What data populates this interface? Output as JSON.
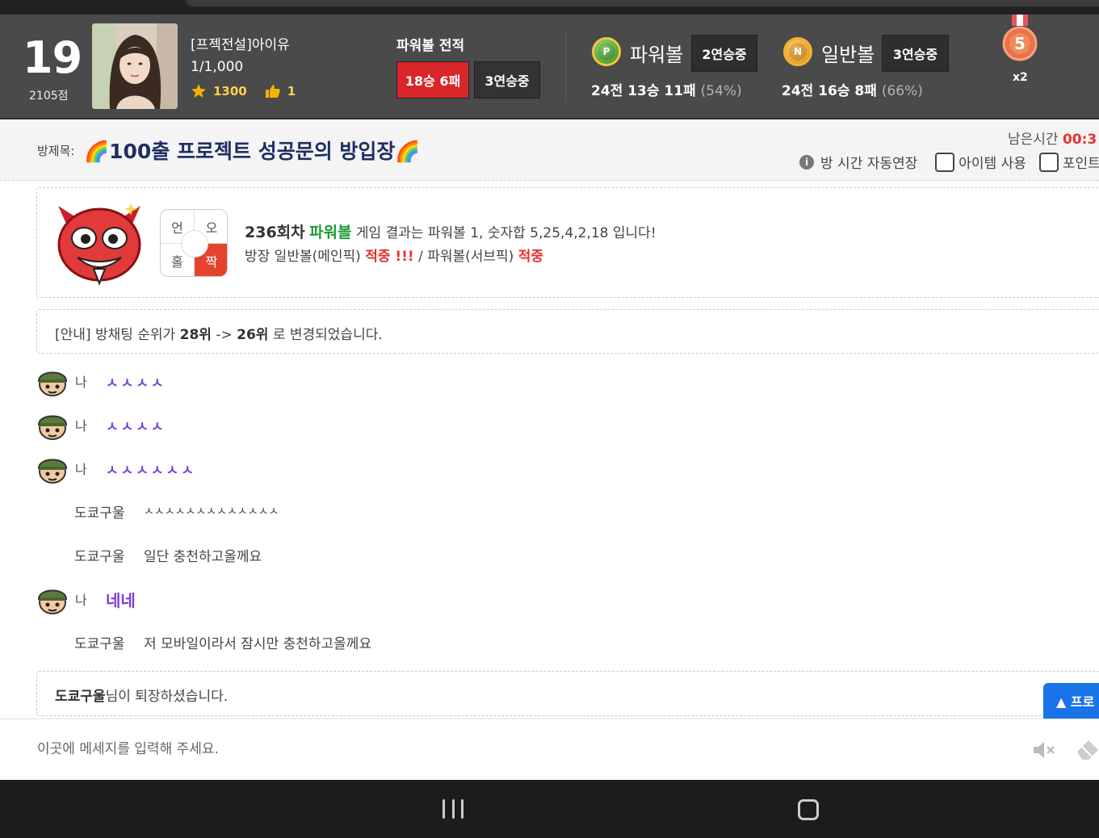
{
  "header": {
    "rank": "19",
    "score": "2105점",
    "nickname": "[프젝전설]아이유",
    "level": "1/1,000",
    "stars": "1300",
    "likes": "1",
    "record_title": "파워볼 전적",
    "record_win": "18승 6패",
    "record_streak": "3연승중",
    "powerball": {
      "label": "파워볼",
      "badge": "P",
      "streak": "2연승중",
      "record": "24전 13승 11패",
      "pct": "(54%)"
    },
    "normalball": {
      "label": "일반볼",
      "badge": "N",
      "streak": "3연승중",
      "record": "24전 16승 8패",
      "pct": "(66%)"
    },
    "medal_number": "5",
    "medal_mult": "x2"
  },
  "titlebar": {
    "label": "방제목:",
    "title": "🌈100출 프로젝트 성공문의 방입장🌈",
    "remain_label": "남은시간",
    "remain_time": "00:3",
    "info_icon": "i",
    "auto_extend": "방 시간 자동연장",
    "item_use": "아이템 사용",
    "point_use": "포인트"
  },
  "result": {
    "grid": [
      "언",
      "오",
      "홀",
      "짝"
    ],
    "round": "236회차",
    "game": "파워볼",
    "text1": " 게임 결과는 파워볼 1, 숫자합 5,25,4,2,18 입니다!",
    "text2a": "방장 일반볼(메인픽) ",
    "hit1": "적중 !!!",
    "text2b": " / 파워볼(서브픽) ",
    "hit2": "적중"
  },
  "notice": {
    "prefix": "[안내] 방채팅 순위가 ",
    "from": "28위",
    "arrow": " -> ",
    "to": "26위",
    "suffix": " 로 변경되었습니다."
  },
  "chat": {
    "me_label": "나",
    "me1": "ㅅㅅㅅㅅ",
    "me2": "ㅅㅅㅅㅅ",
    "me3": "ㅅㅅㅅㅅㅅㅅ",
    "other_name": "도쿄구울",
    "other1": "ㅅㅅㅅㅅㅅㅅㅅㅅㅅㅅㅅㅅㅅ",
    "other2": "일단 충천하고올께요",
    "me4": "네네",
    "other3": "저 모바일이라서 잠시만 충천하고올께요"
  },
  "leave": {
    "name": "도쿄구울",
    "suffix": "님이 퇴장하셨습니다."
  },
  "float_button": "▲ 프로",
  "input": {
    "placeholder": "이곳에 메세지를 입력해 주세요.",
    "value": ""
  }
}
